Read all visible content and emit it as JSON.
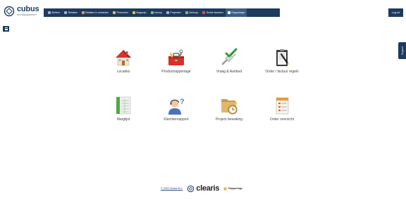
{
  "app": {
    "logo_name": "cubus",
    "logo_subtitle": "beveiligingsplatform"
  },
  "nav": {
    "items": [
      {
        "label": "Beheer",
        "icon": "gear-icon",
        "color": "#9fb4cc",
        "active": false
      },
      {
        "label": "Relaties",
        "icon": "people-icon",
        "color": "#9fb4cc",
        "active": false
      },
      {
        "label": "Relaties & contacten",
        "icon": "contacts-icon",
        "color": "#e8a03a",
        "active": false
      },
      {
        "label": "Personeel",
        "icon": "staff-icon",
        "color": "#f0c040",
        "active": false
      },
      {
        "label": "Magazijn",
        "icon": "warehouse-icon",
        "color": "#f0c040",
        "active": false
      },
      {
        "label": "Inkoop",
        "icon": "purchase-icon",
        "color": "#7ac070",
        "active": false
      },
      {
        "label": "Projecten",
        "icon": "projects-icon",
        "color": "#9fb4cc",
        "active": false
      },
      {
        "label": "Verkoop",
        "icon": "sales-icon",
        "color": "#7ac070",
        "active": false
      },
      {
        "label": "Snelle facturen",
        "icon": "invoice-icon",
        "color": "#e05050",
        "active": false
      },
      {
        "label": "Rapportage",
        "icon": "report-icon",
        "color": "#ffffff",
        "active": true
      }
    ],
    "logout_label": "Log uit"
  },
  "support_label": "Support",
  "tiles": [
    {
      "label": "Locaties",
      "icon": "house-icon"
    },
    {
      "label": "Productrapportage",
      "icon": "toolbox-icon"
    },
    {
      "label": "Vraag & Aanbod",
      "icon": "check-plug-icon"
    },
    {
      "label": "Order / factuur regels",
      "icon": "clipboard-pen-icon"
    },
    {
      "label": "Marglijst",
      "icon": "ledger-icon"
    },
    {
      "label": "Klachtenrapport",
      "icon": "support-person-icon"
    },
    {
      "label": "Project bewaking",
      "icon": "folder-clock-icon"
    },
    {
      "label": "Order overzicht",
      "icon": "document-list-icon"
    }
  ],
  "footer": {
    "copyright": "© 2020 Clearis B.V.",
    "brand": "clearis",
    "breadcrumb": "Rapportage"
  }
}
